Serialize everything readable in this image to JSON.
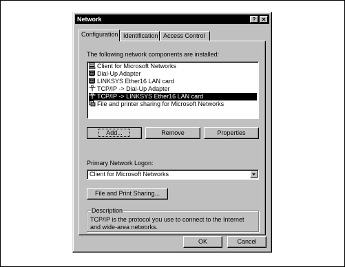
{
  "dialog": {
    "title": "Network",
    "help_glyph": "?",
    "close_glyph": "✕"
  },
  "tabs": [
    {
      "label": "Configuration",
      "active": true
    },
    {
      "label": "Identification",
      "active": false
    },
    {
      "label": "Access Control",
      "active": false
    }
  ],
  "components_label": "The following network components are installed:",
  "components": [
    {
      "label": "Client for Microsoft Networks",
      "icon": "client-icon",
      "selected": false
    },
    {
      "label": "Dial-Up Adapter",
      "icon": "adapter-icon",
      "selected": false
    },
    {
      "label": "LINKSYS Ether16 LAN card",
      "icon": "adapter-icon",
      "selected": false
    },
    {
      "label": "TCP/IP -> Dial-Up Adapter",
      "icon": "protocol-icon",
      "selected": false
    },
    {
      "label": "TCP/IP -> LINKSYS Ether16 LAN card",
      "icon": "protocol-icon",
      "selected": true
    },
    {
      "label": "File and printer sharing for Microsoft Networks",
      "icon": "service-icon",
      "selected": false
    }
  ],
  "buttons": {
    "add": "Add...",
    "remove": "Remove",
    "properties": "Properties",
    "file_print_sharing": "File and Print Sharing...",
    "ok": "OK",
    "cancel": "Cancel"
  },
  "logon": {
    "label": "Primary Network Logon:",
    "value": "Client for Microsoft Networks"
  },
  "description": {
    "legend": "Description",
    "text": "TCP/IP is the protocol you use to connect to the Internet and wide-area networks."
  }
}
